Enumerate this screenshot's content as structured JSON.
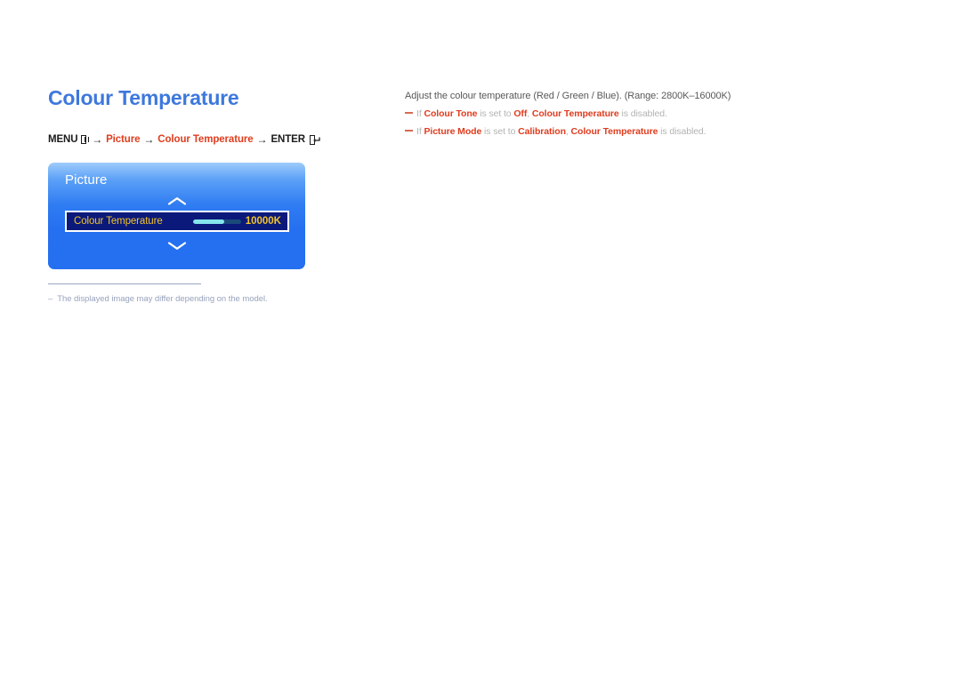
{
  "page": {
    "title": "Colour Temperature"
  },
  "menu_path": {
    "menu_label": "MENU",
    "menu_icon": "menu-grid-icon",
    "arrow": "→",
    "step1": "Picture",
    "step2": "Colour Temperature",
    "enter_label": "ENTER",
    "enter_icon": "enter-return-icon"
  },
  "osd": {
    "header": "Picture",
    "chevron_up_icon": "chevron-up-icon",
    "chevron_down_icon": "chevron-down-icon",
    "row": {
      "label": "Colour Temperature",
      "value": "10000K",
      "slider_fill_percent": 66
    },
    "colors": {
      "panel_top": "#9ecbfb",
      "panel_bottom": "#2470f0",
      "row_background": "#0b1a7a",
      "row_text": "#f3c32a",
      "slider_fill": "#84e6ec",
      "slider_track": "#1b4a7a"
    }
  },
  "footnote": {
    "dash": "‒",
    "text": "The displayed image may differ depending on the model."
  },
  "description": {
    "main": "Adjust the colour temperature (Red / Green / Blue). (Range: 2800K–16000K)",
    "notes": [
      {
        "prefix": "If",
        "term1": "Colour Tone",
        "mid": "is set to",
        "term2": "Off",
        "comma": ",",
        "term3": "Colour Temperature",
        "suffix": "is disabled."
      },
      {
        "prefix": "If",
        "term1": "Picture Mode",
        "mid": "is set to",
        "term2": "Calibration",
        "comma": ",",
        "term3": "Colour Temperature",
        "suffix": "is disabled."
      }
    ]
  },
  "theme": {
    "title_blue": "#3d78dd",
    "accent_red": "#e03c1e",
    "body_grey": "#595959",
    "muted_grey": "#b3b3b3",
    "footnote_grey": "#99a3bd"
  }
}
